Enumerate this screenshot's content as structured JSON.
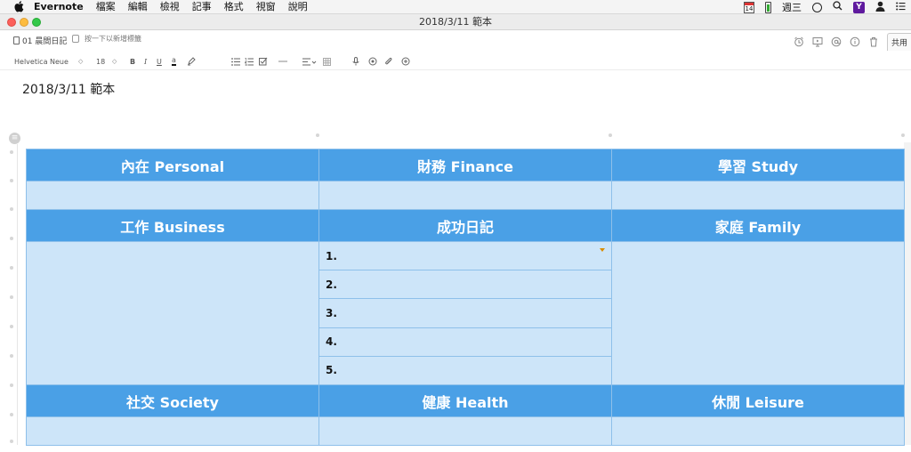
{
  "menubar": {
    "app_name": "Evernote",
    "menus": [
      "檔案",
      "編輯",
      "檢視",
      "記事",
      "格式",
      "視窗",
      "說明"
    ],
    "calendar_day": "14",
    "weekday": "週三"
  },
  "window": {
    "title": "2018/3/11 範本"
  },
  "note_header": {
    "notebook": "01 晨間日記",
    "tag_placeholder": "按一下以新增標籤",
    "share_label": "共用"
  },
  "toolbar": {
    "font_family": "Helvetica Neue",
    "font_size": "18",
    "bold": "B",
    "italic": "I",
    "underline": "U",
    "text_color": "a",
    "dropdown_arrow": "◇"
  },
  "note": {
    "title": "2018/3/11 範本"
  },
  "table": {
    "row1_headers": [
      "內在 Personal",
      "財務 Finance",
      "學習 Study"
    ],
    "row2_headers": [
      "工作 Business",
      "成功日記",
      "家庭 Family"
    ],
    "success_items": [
      "1.",
      "2.",
      "3.",
      "4.",
      "5."
    ],
    "row3_headers": [
      "社交 Society",
      "健康 Health",
      "休閒 Leisure"
    ]
  },
  "colors": {
    "header_blue": "#4aa0e6",
    "cell_light_blue": "#cde5f9",
    "border_blue": "#8ec0ea"
  }
}
